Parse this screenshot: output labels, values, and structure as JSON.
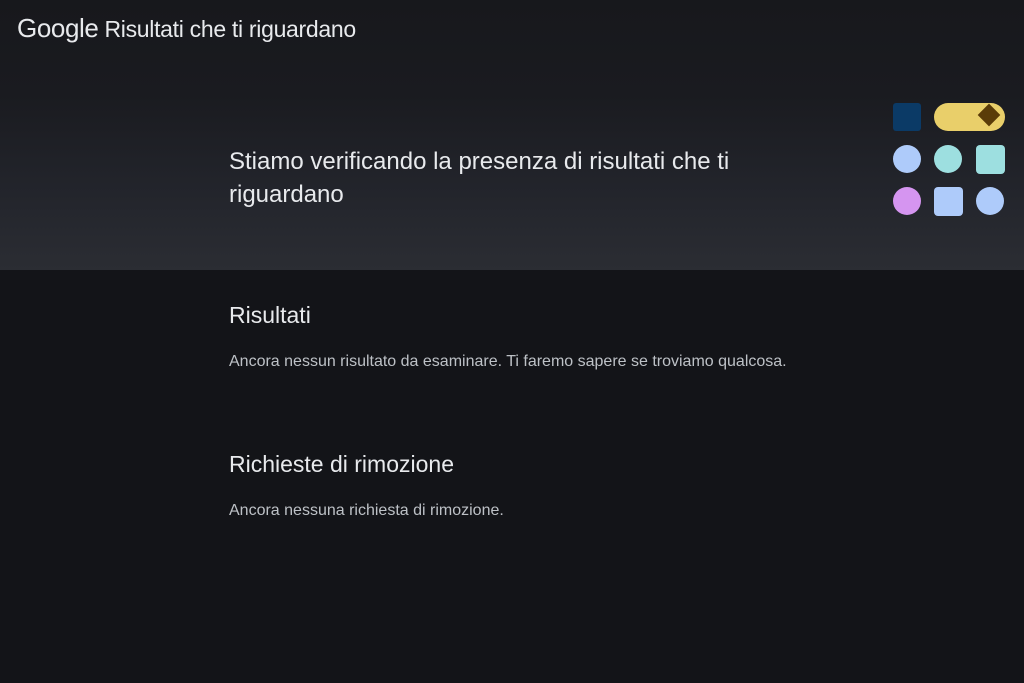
{
  "header": {
    "brand": "Google",
    "title": "Risultati che ti riguardano"
  },
  "hero": {
    "heading_line1": "Stiamo verificando la presenza di risultati che ti",
    "heading_line2": "riguardano"
  },
  "results_section": {
    "title": "Risultati",
    "message": "Ancora nessun risultato da esaminare. Ti faremo sapere se troviamo qualcosa."
  },
  "removal_section": {
    "title": "Richieste di rimozione",
    "message": "Ancora nessuna richiesta di rimozione."
  },
  "colors": {
    "background": "#131418",
    "text": "#e8eaed",
    "muted_text": "#bdc1c6",
    "navy": "#0b3a66",
    "yellow": "#e9cf6a",
    "brown": "#5a3c08",
    "light_blue": "#aecbfa",
    "teal": "#9ddfe0",
    "purple": "#d595f0"
  }
}
